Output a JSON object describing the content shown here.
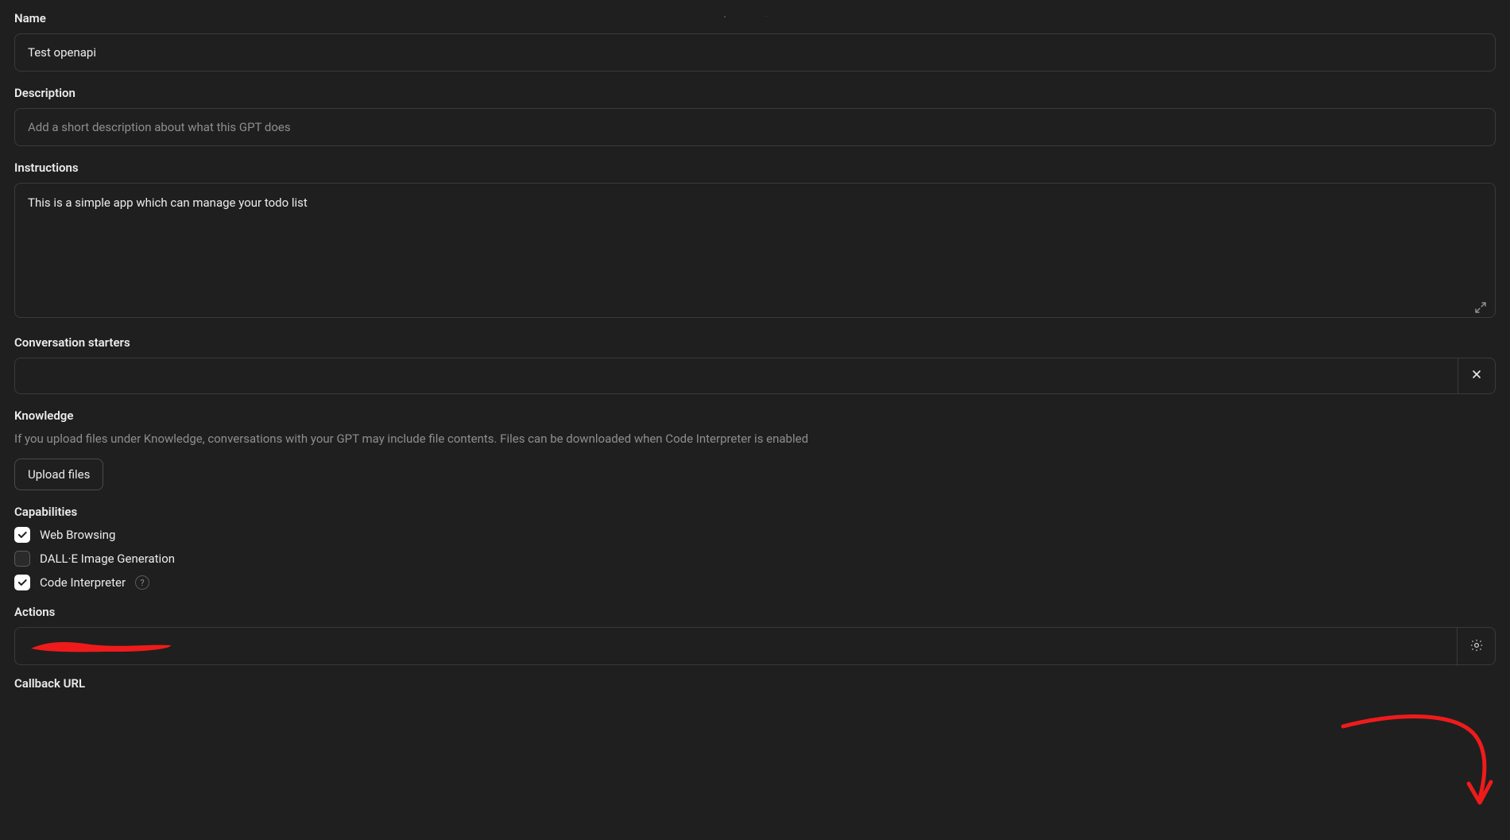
{
  "fields": {
    "name": {
      "label": "Name",
      "value": "Test openapi"
    },
    "description": {
      "label": "Description",
      "value": "",
      "placeholder": "Add a short description about what this GPT does"
    },
    "instructions": {
      "label": "Instructions",
      "value": "This is a simple app which can manage your todo list"
    },
    "starters": {
      "label": "Conversation starters",
      "value": ""
    },
    "knowledge": {
      "label": "Knowledge",
      "description": "If you upload files under Knowledge, conversations with your GPT may include file contents. Files can be downloaded when Code Interpreter is enabled",
      "upload_button": "Upload files"
    },
    "capabilities": {
      "label": "Capabilities",
      "items": [
        {
          "label": "Web Browsing",
          "checked": true,
          "help": false
        },
        {
          "label": "DALL·E Image Generation",
          "checked": false,
          "help": false
        },
        {
          "label": "Code Interpreter",
          "checked": true,
          "help": true
        }
      ]
    },
    "actions": {
      "label": "Actions"
    },
    "callback": {
      "label": "Callback URL"
    }
  }
}
